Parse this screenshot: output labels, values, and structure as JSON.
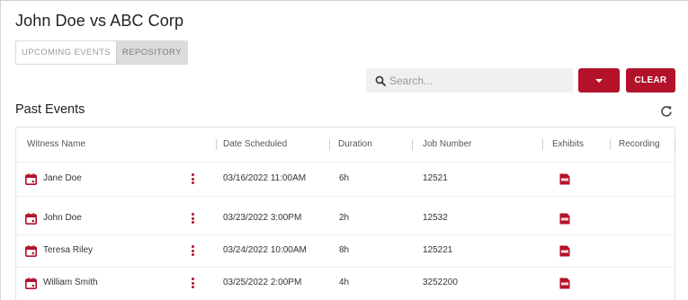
{
  "case": {
    "title": "John Doe vs ABC Corp"
  },
  "tabs": [
    {
      "label": "UPCOMING EVENTS",
      "active": false
    },
    {
      "label": "REPOSITORY",
      "active": true
    }
  ],
  "search": {
    "placeholder": "Search...",
    "value": "",
    "icon": "search-icon"
  },
  "toolbar": {
    "dropdown_icon": "caret-down-icon",
    "clear_label": "CLEAR"
  },
  "section": {
    "title": "Past Events",
    "refresh_icon": "refresh-icon"
  },
  "table": {
    "columns": [
      "Witness Name",
      "Date Scheduled",
      "Duration",
      "Job Number",
      "Exhibits",
      "Recording"
    ],
    "rows": [
      {
        "witness": "Jane Doe",
        "date": "03/16/2022 11:00AM",
        "duration": "6h",
        "job": "12521",
        "exhibits_icon": "pdf-icon"
      },
      {
        "witness": "John Doe",
        "date": "03/23/2022 3:00PM",
        "duration": "2h",
        "job": "12532",
        "exhibits_icon": "pdf-icon"
      },
      {
        "witness": "Teresa Riley",
        "date": "03/24/2022 10:00AM",
        "duration": "8h",
        "job": "125221",
        "exhibits_icon": "pdf-icon"
      },
      {
        "witness": "William Smith",
        "date": "03/25/2022 2:00PM",
        "duration": "4h",
        "job": "3252200",
        "exhibits_icon": "pdf-icon"
      }
    ]
  },
  "colors": {
    "accent": "#b3122a",
    "tab_active_bg": "#dcdcdc",
    "search_bg": "#f0f0f0"
  }
}
